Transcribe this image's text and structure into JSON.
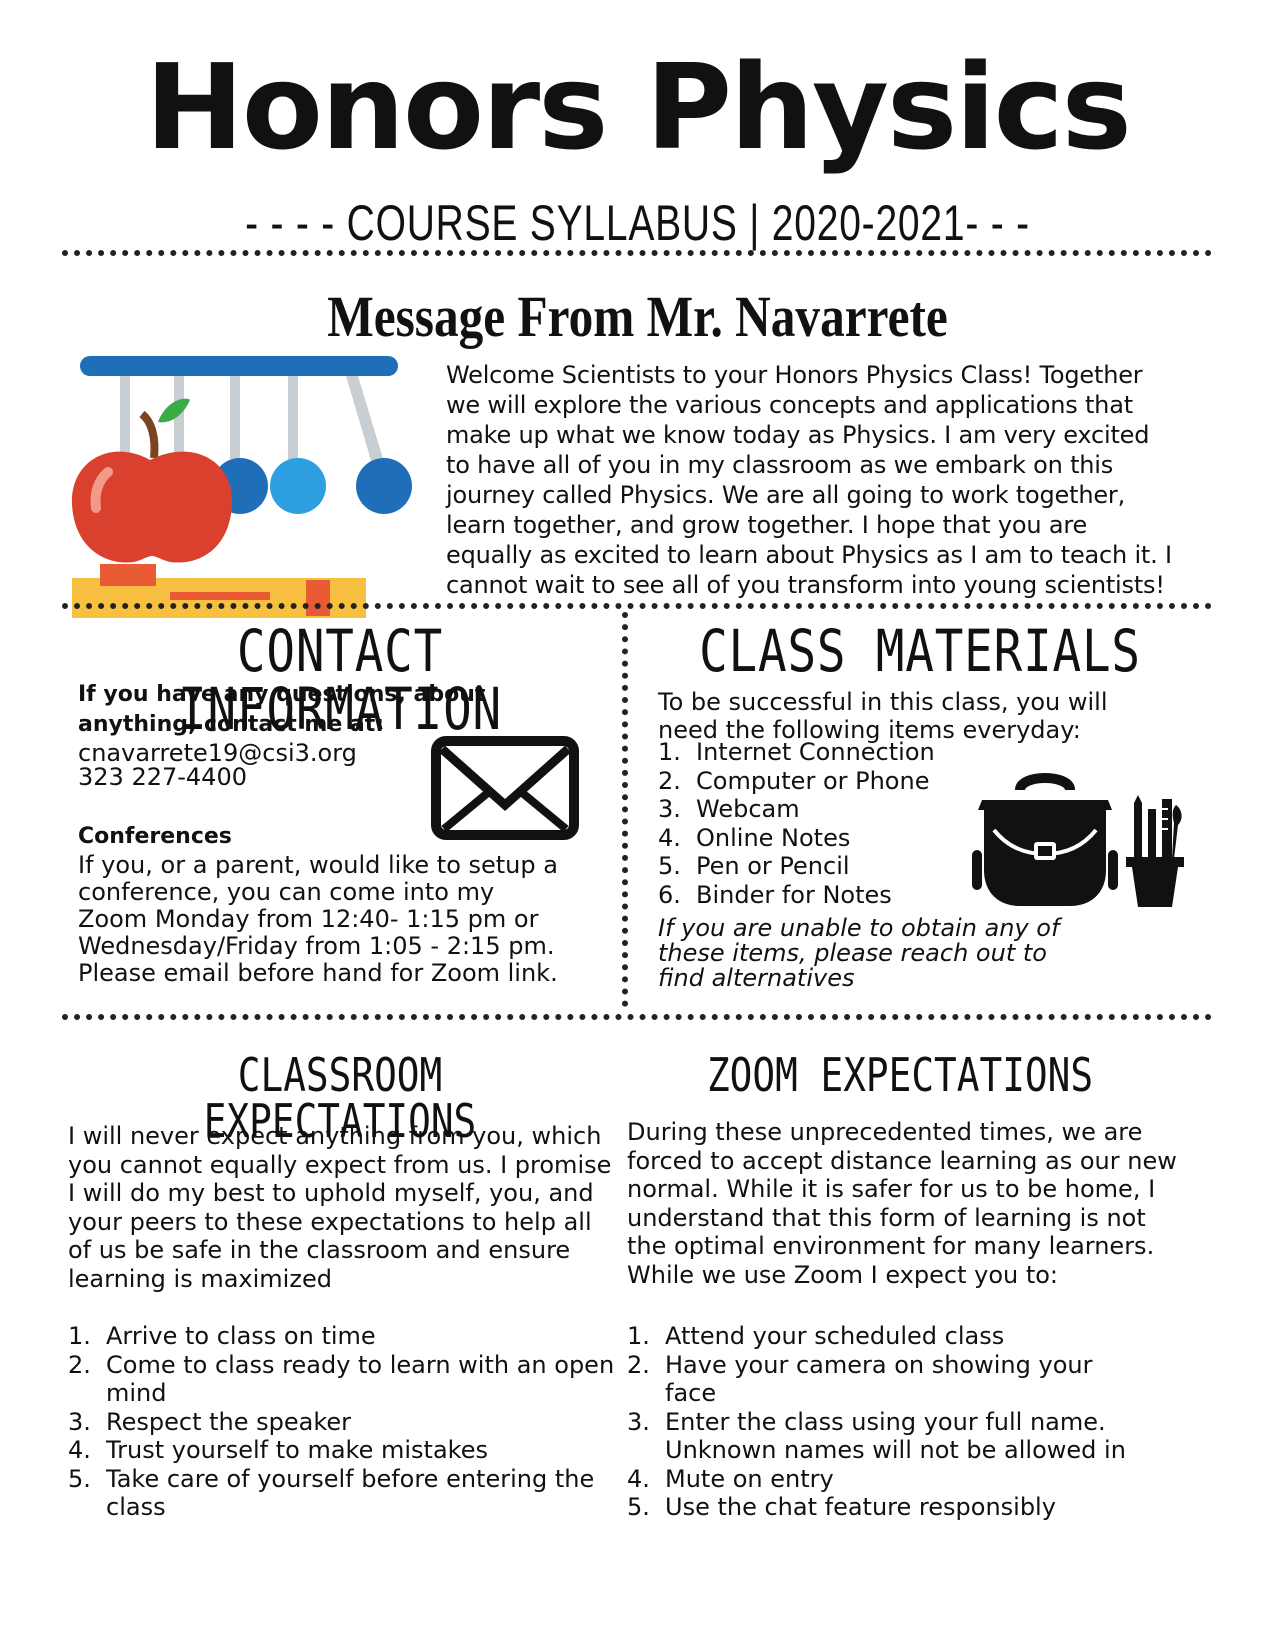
{
  "header": {
    "title": "Honors Physics",
    "subtitle": "- - - - COURSE SYLLABUS | 2020-2021- - -"
  },
  "message": {
    "title": "Message From Mr. Navarrete",
    "body": "Welcome Scientists to your Honors Physics Class! Together we will explore the various concepts and applications that make up what we know today as Physics. I am very excited to have all of you in my classroom as we embark on this journey called Physics. We are all going to work together, learn together, and grow together. I hope that you are equally as excited to learn about Physics as I am to teach it. I cannot wait to see all of you transform into young scientists!"
  },
  "contact": {
    "heading": "CONTACT INFORMATION",
    "intro": "If you have any questions, about anything, contact me at:",
    "email": "cnavarrete19@csi3.org",
    "phone": "323 227-4400",
    "conferences_heading": "Conferences",
    "conferences_text": "If you, or a parent, would like to setup a conference, you can come into my Zoom Monday from 12:40- 1:15 pm or Wednesday/Friday from 1:05 -   2:15 pm. Please email before hand for Zoom link."
  },
  "materials": {
    "heading": "CLASS MATERIALS",
    "intro": "To be successful in this class, you will need the following items everyday:",
    "items": [
      {
        "num": "1.",
        "label": "Internet Connection"
      },
      {
        "num": "2.",
        "label": "Computer or Phone"
      },
      {
        "num": "3.",
        "label": "Webcam"
      },
      {
        "num": "4.",
        "label": "Online Notes"
      },
      {
        "num": "5.",
        "label": "Pen or Pencil"
      },
      {
        "num": "6.",
        "label": "Binder for Notes"
      }
    ],
    "note": "If you are unable to obtain any of these items, please reach out to find alternatives"
  },
  "classroom": {
    "heading": "CLASSROOM EXPECTATIONS",
    "intro": "I will never expect anything from you, which you cannot equally expect from us. I promise I will do my best to uphold myself, you, and your peers to these expectations to help all of us be safe in the classroom and ensure learning is maximized",
    "items": [
      {
        "num": "1.",
        "label": "Arrive to class on time"
      },
      {
        "num": "2.",
        "label": "Come to class ready to learn with an open mind"
      },
      {
        "num": "3.",
        "label": "Respect the speaker"
      },
      {
        "num": "4.",
        "label": "Trust yourself to make mistakes"
      },
      {
        "num": "5.",
        "label": "Take care of yourself before entering the class"
      }
    ]
  },
  "zoom": {
    "heading": "ZOOM EXPECTATIONS",
    "intro": "During these unprecedented times, we are forced to accept distance learning as our new normal. While it is safer for us to be home, I understand that this form of learning is not the optimal environment for many learners. While we use Zoom I expect you to:",
    "items": [
      {
        "num": "1.",
        "label": "Attend your scheduled class"
      },
      {
        "num": "2.",
        "label": "Have your camera on showing your face"
      },
      {
        "num": "3.",
        "label": "Enter the class using your full name. Unknown names will not be allowed in"
      },
      {
        "num": "4.",
        "label": "Mute on entry"
      },
      {
        "num": "5.",
        "label": "Use the chat feature responsibly"
      }
    ]
  },
  "icons": {
    "illustration": "apple-pendulum-book-icon",
    "envelope": "envelope-icon",
    "backpack": "backpack-icon",
    "pencil_cup": "pencil-cup-icon"
  }
}
